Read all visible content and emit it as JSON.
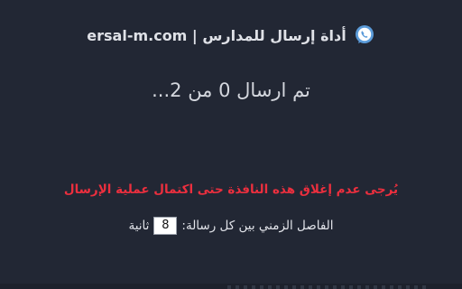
{
  "header": {
    "title": "أداة إرسال للمدارس | ersal-m.com",
    "icon": "whatsapp-icon",
    "icon_color": "#5b9bd9"
  },
  "status": {
    "text": "تم ارسال 0 من 2..."
  },
  "warning": {
    "text": "يُرجى عدم إغلاق هذه النافذة حتى اكتمال عملية الإرسال",
    "color": "#ec2f3e"
  },
  "interval": {
    "label": "الفاصل الزمني بين كل رسالة:",
    "value": "8",
    "unit": "ثانية"
  },
  "theme": {
    "background": "#222734"
  }
}
